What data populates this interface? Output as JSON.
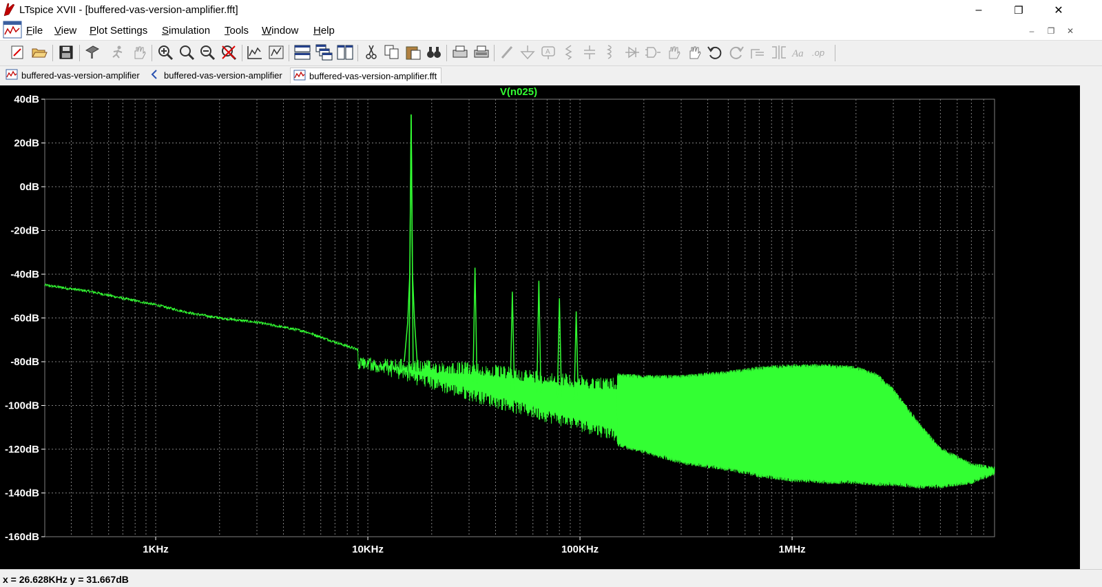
{
  "window": {
    "title": "LTspice XVII - [buffered-vas-version-amplifier.fft]",
    "minimize_glyph": "–",
    "restore_glyph": "❐",
    "close_glyph": "✕"
  },
  "menu": {
    "items": [
      {
        "accel": "F",
        "rest": "ile"
      },
      {
        "accel": "V",
        "rest": "iew"
      },
      {
        "accel": "P",
        "rest": "lot Settings"
      },
      {
        "accel": "S",
        "rest": "imulation"
      },
      {
        "accel": "T",
        "rest": "ools"
      },
      {
        "accel": "W",
        "rest": "indow"
      },
      {
        "accel": "H",
        "rest": "elp"
      }
    ],
    "mdi_minimize": "–",
    "mdi_restore": "❐",
    "mdi_close": "✕"
  },
  "toolbar": {
    "icons": [
      "new-schematic-icon",
      "open-icon",
      "save-icon",
      "control-panel-icon",
      "run-icon",
      "halt-icon",
      "zoom-in-icon",
      "zoom-area-icon",
      "zoom-out-icon",
      "zoom-cancel-icon",
      "autorange-icon",
      "plot-settings-icon",
      "tile-horizontal-icon",
      "cascade-icon",
      "tile-vertical-icon",
      "cut-icon",
      "copy-icon",
      "paste-icon",
      "find-icon",
      "print-icon",
      "print-preview-icon",
      "wire-icon",
      "ground-icon",
      "label-net-icon",
      "resistor-icon",
      "capacitor-icon",
      "inductor-icon",
      "diode-icon",
      "component-icon",
      "move-icon",
      "drag-icon",
      "undo-icon",
      "redo-icon",
      "rotate-icon",
      "mirror-icon",
      "text-icon",
      "spice-directive-icon"
    ]
  },
  "tabs": [
    {
      "label": "buffered-vas-version-amplifier",
      "icon": "waveform-icon"
    },
    {
      "label": "buffered-vas-version-amplifier",
      "icon": "schematic-icon"
    },
    {
      "label": "buffered-vas-version-amplifier.fft",
      "icon": "waveform-icon",
      "active": true
    }
  ],
  "status": {
    "text": "x = 26.628KHz    y = 31.667dB"
  },
  "colors": {
    "plot_background": "#000000",
    "trace": "#33ff33",
    "grid": "#808080",
    "axis_text": "#ffffff"
  },
  "chart_data": {
    "type": "line",
    "title": "V(n025)",
    "x_scale": "log",
    "xlim_hz": [
      300,
      9000000
    ],
    "ylim_db": [
      -160,
      40
    ],
    "grid": true,
    "y_ticks": [
      "40dB",
      "20dB",
      "0dB",
      "-20dB",
      "-40dB",
      "-60dB",
      "-80dB",
      "-100dB",
      "-120dB",
      "-140dB",
      "-160dB"
    ],
    "y_tick_values": [
      40,
      20,
      0,
      -20,
      -40,
      -60,
      -80,
      -100,
      -120,
      -140,
      -160
    ],
    "x_ticks": [
      "1KHz",
      "10KHz",
      "100KHz",
      "1MHz"
    ],
    "x_tick_values_hz": [
      1000,
      10000,
      100000,
      1000000
    ],
    "series": [
      {
        "name": "V(n025)",
        "baseline": {
          "x_hz": [
            300,
            500,
            700,
            1000,
            1500,
            2000,
            3000,
            5000,
            7000,
            10000,
            13000,
            15000,
            20000,
            25000,
            30000,
            40000,
            50000,
            70000,
            100000,
            150000,
            200000,
            300000,
            500000,
            700000,
            1000000,
            1500000,
            2000000,
            2500000,
            3000000,
            4000000,
            5000000,
            7000000,
            9000000
          ],
          "y_db": [
            -45,
            -48,
            -51,
            -54,
            -58,
            -60,
            -62,
            -66,
            -71,
            -76,
            -80,
            -84,
            -86,
            -88,
            -90,
            -91,
            -93,
            -95,
            -98,
            -100,
            -104,
            -108,
            -111,
            -112,
            -113,
            -113,
            -112,
            -113,
            -115,
            -119,
            -123,
            -128,
            -130
          ]
        },
        "envelope": {
          "x_hz": [
            10000,
            30000,
            100000,
            200000,
            300000,
            500000,
            700000,
            1000000,
            1500000,
            2000000,
            2500000,
            3000000,
            4000000,
            5000000,
            7000000,
            9000000
          ],
          "y_upper_db": [
            -78,
            -80,
            -86,
            -88,
            -88,
            -86,
            -84,
            -83,
            -83,
            -84,
            -87,
            -94,
            -110,
            -121,
            -128,
            -130
          ],
          "y_lower_db": [
            -84,
            -98,
            -112,
            -120,
            -125,
            -128,
            -131,
            -133,
            -134,
            -134,
            -135,
            -135,
            -136,
            -136,
            -134,
            -130
          ]
        },
        "peaks": [
          {
            "x_hz": 16000,
            "y_db": 33
          },
          {
            "x_hz": 32000,
            "y_db": -37
          },
          {
            "x_hz": 48000,
            "y_db": -48
          },
          {
            "x_hz": 64000,
            "y_db": -43
          },
          {
            "x_hz": 80000,
            "y_db": -51
          },
          {
            "x_hz": 96000,
            "y_db": -57
          }
        ]
      }
    ]
  }
}
